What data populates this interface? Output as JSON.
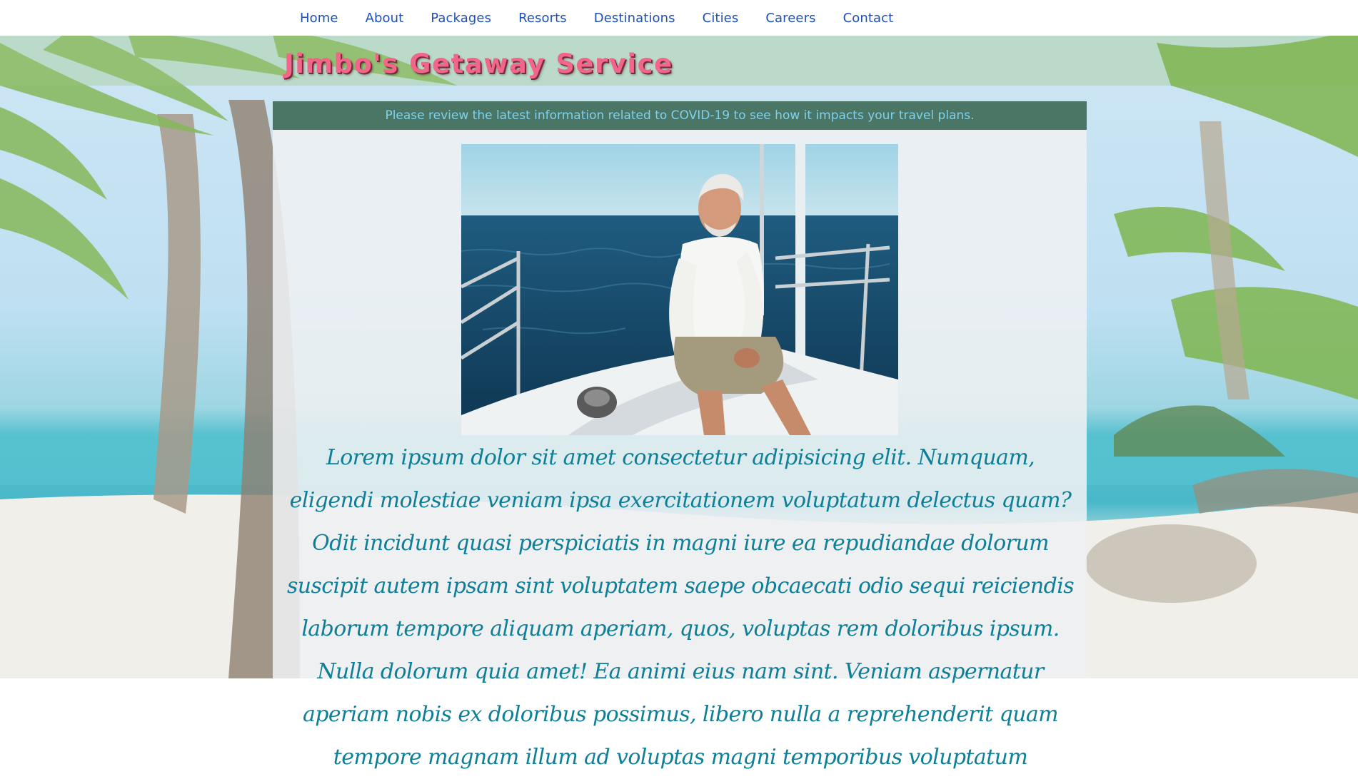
{
  "nav": {
    "items": [
      {
        "label": "Home"
      },
      {
        "label": "About"
      },
      {
        "label": "Packages"
      },
      {
        "label": "Resorts"
      },
      {
        "label": "Destinations"
      },
      {
        "label": "Cities"
      },
      {
        "label": "Careers"
      },
      {
        "label": "Contact"
      }
    ]
  },
  "header": {
    "title": "Jimbo's Getaway Service"
  },
  "alert": {
    "text": "Please review the latest information related to COVID-19 to see how it impacts your travel plans."
  },
  "main": {
    "paragraph": "Lorem ipsum dolor sit amet consectetur adipisicing elit. Numquam, eligendi molestiae veniam ipsa exercitationem voluptatum delectus quam? Odit incidunt quasi perspiciatis in magni iure ea repudiandae dolorum suscipit autem ipsam sint voluptatem saepe obcaecati odio sequi reiciendis laborum tempore aliquam aperiam, quos, voluptas rem doloribus ipsum. Nulla dolorum quia amet! Ea animi eius nam sint. Veniam aspernatur aperiam nobis ex doloribus possimus, libero nulla a reprehenderit quam tempore magnam illum ad voluptas magni temporibus voluptatum"
  },
  "colors": {
    "nav_link": "#1f4fb8",
    "title": "#f2668a",
    "alert_bg": "#285a46",
    "alert_text": "#7fd2ec",
    "body_text": "#0f7f98"
  },
  "icons": {
    "hero_image": "man-on-sailboat-photo",
    "background": "tropical-beach-palms-photo"
  }
}
